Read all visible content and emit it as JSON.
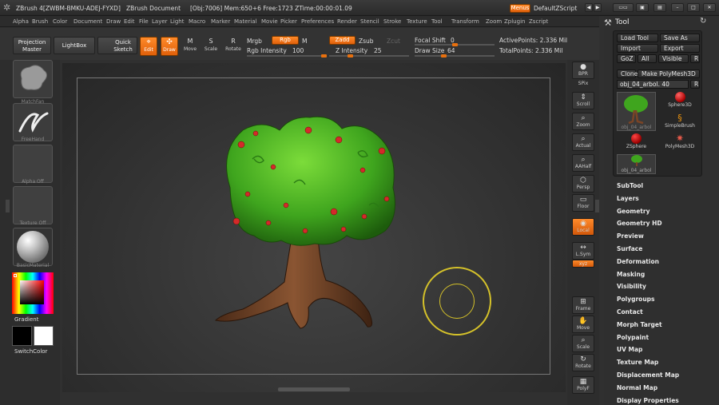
{
  "title": {
    "app": "ZBrush 4[ZWBM-BMKU-ADEJ-FYXD]",
    "document": "ZBrush Document",
    "status": "[Obj:7006] Mem:650+6 Free:1723 ZTime:00:00:01.09",
    "menus_button": "Menus",
    "script": "DefaultZScript"
  },
  "menubar": [
    "Alpha",
    "Brush",
    "Color",
    "Document",
    "Draw",
    "Edit",
    "File",
    "Layer",
    "Light",
    "Macro",
    "Marker",
    "Material",
    "Movie",
    "Picker",
    "Preferences",
    "Render",
    "Stencil",
    "Stroke",
    "Texture",
    "Tool",
    "Transform",
    "Zoom",
    "Zplugin",
    "Zscript"
  ],
  "toolbar": {
    "projection": "Projection",
    "projection2": "Master",
    "lightbox": "LightBox",
    "quick": "Quick",
    "sketch": "Sketch",
    "edit": "Edit",
    "draw": "Draw",
    "move": "Move",
    "scale": "Scale",
    "rotate": "Rotate",
    "mrgb": "Mrgb",
    "rgb": "Rgb",
    "m": "M",
    "rgb_intensity_label": "Rgb Intensity",
    "rgb_intensity_value": "100",
    "rgb_intensity_pct": 1.0,
    "zadd": "Zadd",
    "zsub": "Zsub",
    "zcut": "Zcut",
    "z_intensity_label": "Z Intensity",
    "z_intensity_value": "25",
    "z_intensity_pct": 0.25,
    "focal_shift_label": "Focal Shift",
    "focal_shift_value": "0",
    "focal_shift_pct": 0.5,
    "draw_size_label": "Draw Size",
    "draw_size_value": "64",
    "draw_size_pct": 0.35,
    "active_points": "ActivePoints: 2.336 Mil",
    "total_points": "TotalPoints: 2.336 Mil"
  },
  "left_shelf": {
    "brush": "MatchFan",
    "stroke": "FreeHand",
    "alpha": "Alpha Off",
    "texture": "Texture Off",
    "material": "BasicMaterial",
    "gradient": "Gradient",
    "switch_color": "SwitchColor"
  },
  "right_shelf": [
    "BPR",
    "SPix",
    "Scroll",
    "Zoom",
    "Actual",
    "AAHalf",
    "Persp",
    "Floor",
    "Local",
    "L.Sym",
    "XYZ",
    "Frame",
    "Move",
    "Scale",
    "Rotate",
    "PolyF"
  ],
  "tool_panel": {
    "header": "Tool",
    "load_tool": "Load Tool",
    "save_as": "Save As",
    "import": "Import",
    "export": "Export",
    "goz": "GoZ",
    "all": "All",
    "visible": "Visible",
    "r": "R",
    "clone": "Clone",
    "make_polymesh": "Make PolyMesh3D",
    "current_tool": "obj_04_arbol.",
    "current_value": "40",
    "tools": [
      {
        "name": "obj_04_arbol",
        "icon": "tree-icon"
      },
      {
        "name": "Sphere3D",
        "icon": "sphere-icon"
      },
      {
        "name": "SimpleBrush",
        "icon": "simplebrush-icon"
      },
      {
        "name": "ZSphere",
        "icon": "zsphere-icon"
      },
      {
        "name": "PolyMesh3D",
        "icon": "star-icon"
      },
      {
        "name": "obj_04_arbol",
        "icon": "tree-icon"
      }
    ]
  },
  "tool_menu": [
    "SubTool",
    "Layers",
    "Geometry",
    "Geometry HD",
    "Preview",
    "Surface",
    "Deformation",
    "Masking",
    "Visibility",
    "Polygroups",
    "Contact",
    "Morph Target",
    "Polypaint",
    "UV Map",
    "Texture Map",
    "Displacement Map",
    "Normal Map",
    "Display Properties"
  ],
  "colors": {
    "accent": "#e8700e",
    "tree_foliage": "#4fb42a",
    "tree_trunk": "#7a4426",
    "cursor_ring": "#d4c12a"
  }
}
